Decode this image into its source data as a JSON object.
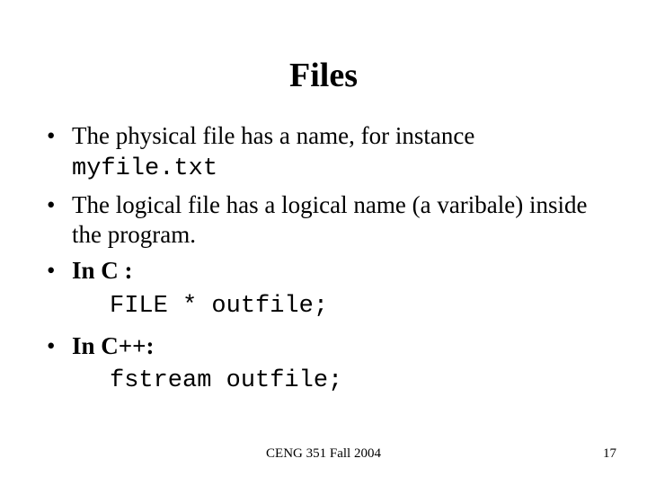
{
  "title": "Files",
  "bullets": {
    "b1_a": "The physical file has a name, for instance ",
    "b1_b": "myfile.txt",
    "b2": "The logical file has a logical name (a varibale) inside the program.",
    "b3": "In C :",
    "code_c": "FILE * outfile;",
    "b4": "In C++:",
    "code_cpp": "fstream outfile;"
  },
  "footer": {
    "center": "CENG 351 Fall 2004",
    "page": "17"
  }
}
